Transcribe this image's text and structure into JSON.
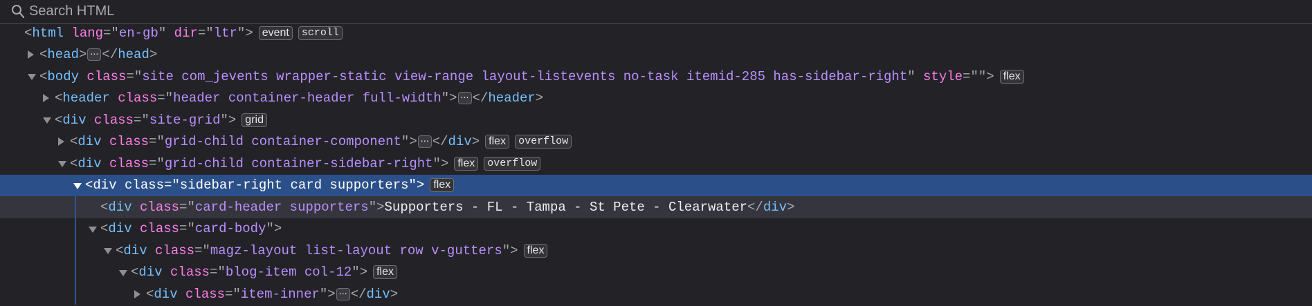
{
  "search": {
    "placeholder": "Search HTML",
    "icon": "search-icon"
  },
  "colors": {
    "background": "#232327",
    "selected_row": "#2b5089",
    "tag": "#75bfff",
    "attr_name": "#ff7de9",
    "attr_value": "#b98eff"
  },
  "rows": [
    {
      "level": 0,
      "expander": null,
      "tag": "html",
      "attrs": [
        {
          "name": "lang",
          "value": "en-gb"
        },
        {
          "name": "dir",
          "value": "ltr"
        }
      ],
      "badges": [
        {
          "label": "event",
          "mono": false
        },
        {
          "label": "scroll",
          "mono": true
        }
      ]
    },
    {
      "level": 1,
      "expander": "closed",
      "tag": "head",
      "attrs": [],
      "collapsed": true,
      "close": "head",
      "badges": []
    },
    {
      "level": 1,
      "expander": "open",
      "tag": "body",
      "attrs": [
        {
          "name": "class",
          "value": "site com_jevents wrapper-static view-range layout-listevents no-task itemid-285 has-sidebar-right"
        },
        {
          "name": "style",
          "value": ""
        }
      ],
      "badges": [
        {
          "label": "flex",
          "mono": false
        }
      ]
    },
    {
      "level": 2,
      "expander": "closed",
      "tag": "header",
      "attrs": [
        {
          "name": "class",
          "value": "header container-header full-width"
        }
      ],
      "collapsed": true,
      "close": "header",
      "badges": []
    },
    {
      "level": 2,
      "expander": "open",
      "tag": "div",
      "attrs": [
        {
          "name": "class",
          "value": "site-grid"
        }
      ],
      "badges": [
        {
          "label": "grid",
          "mono": false
        }
      ]
    },
    {
      "level": 3,
      "expander": "closed",
      "tag": "div",
      "attrs": [
        {
          "name": "class",
          "value": "grid-child container-component"
        }
      ],
      "collapsed": true,
      "close": "div",
      "badges": [
        {
          "label": "flex",
          "mono": false
        },
        {
          "label": "overflow",
          "mono": true
        }
      ]
    },
    {
      "level": 3,
      "expander": "open",
      "tag": "div",
      "attrs": [
        {
          "name": "class",
          "value": "grid-child container-sidebar-right"
        }
      ],
      "badges": [
        {
          "label": "flex",
          "mono": false
        },
        {
          "label": "overflow",
          "mono": true
        }
      ]
    },
    {
      "level": 4,
      "expander": "open",
      "tag": "div",
      "attrs": [
        {
          "name": "class",
          "value": "sidebar-right card supporters"
        }
      ],
      "selected": true,
      "badges": [
        {
          "label": "flex",
          "mono": false
        }
      ]
    },
    {
      "level": 5,
      "expander": null,
      "tag": "div",
      "attrs": [
        {
          "name": "class",
          "value": "card-header supporters"
        }
      ],
      "hover": true,
      "text": "Supporters - FL - Tampa - St Pete - Clearwater",
      "close": "div",
      "badges": []
    },
    {
      "level": 5,
      "expander": "open",
      "tag": "div",
      "attrs": [
        {
          "name": "class",
          "value": "card-body"
        }
      ],
      "badges": []
    },
    {
      "level": 6,
      "expander": "open",
      "tag": "div",
      "attrs": [
        {
          "name": "class",
          "value": "magz-layout list-layout row v-gutters"
        }
      ],
      "badges": [
        {
          "label": "flex",
          "mono": false
        }
      ]
    },
    {
      "level": 7,
      "expander": "open",
      "tag": "div",
      "attrs": [
        {
          "name": "class",
          "value": "blog-item col-12"
        }
      ],
      "badges": [
        {
          "label": "flex",
          "mono": false
        }
      ]
    },
    {
      "level": 8,
      "expander": "closed",
      "tag": "div",
      "attrs": [
        {
          "name": "class",
          "value": "item-inner"
        }
      ],
      "collapsed": true,
      "close": "div",
      "badges": []
    }
  ]
}
